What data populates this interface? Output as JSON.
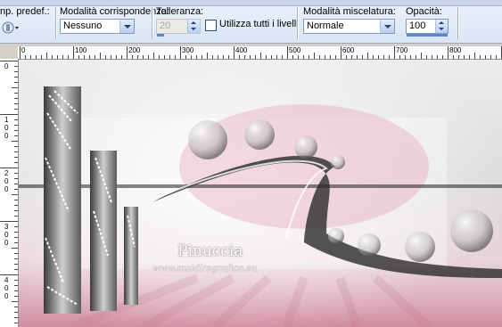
{
  "toolbar": {
    "preset_label": "np. predef.:",
    "match_mode_label": "Modalità corrispondenza:",
    "match_mode_value": "Nessuno",
    "tolerance_label": "Tolleranza:",
    "tolerance_value": "20",
    "all_layers_label": "Utilizza tutti i livelli",
    "all_layers_checked": false,
    "blend_mode_label": "Modalità miscelatura:",
    "blend_mode_value": "Normale",
    "opacity_label": "Opacità:",
    "opacity_value": "100"
  },
  "ruler": {
    "horizontal_labels": [
      "0",
      "100",
      "200",
      "300",
      "400",
      "500",
      "600",
      "700",
      "800"
    ],
    "vertical_labels": [
      "0",
      "100",
      "200",
      "300",
      "400"
    ]
  },
  "canvas": {
    "watermark_name": "Pinuccia",
    "watermark_url": "www.maidiregrafica.eu"
  }
}
